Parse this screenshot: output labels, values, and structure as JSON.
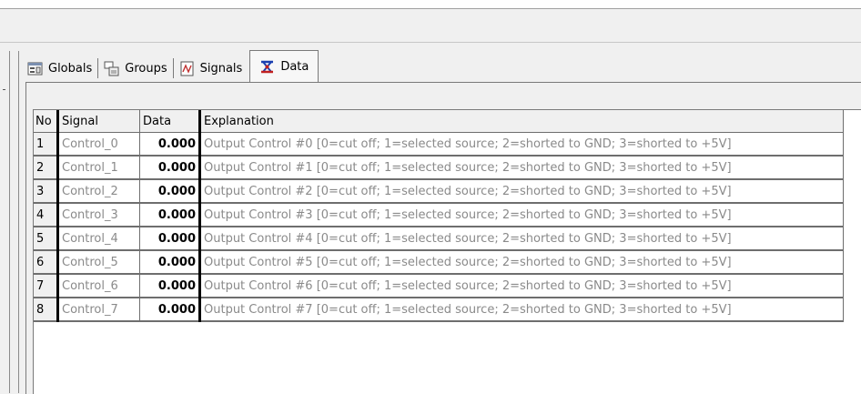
{
  "tabs": [
    {
      "label": "Globals",
      "icon": "globals-icon"
    },
    {
      "label": "Groups",
      "icon": "groups-icon"
    },
    {
      "label": "Signals",
      "icon": "signals-icon"
    },
    {
      "label": "Data",
      "icon": "data-icon",
      "active": true
    }
  ],
  "table": {
    "headers": {
      "no": "No",
      "signal": "Signal",
      "data": "Data",
      "explanation": "Explanation"
    },
    "rows": [
      {
        "no": "1",
        "signal": "Control_0",
        "data": "0.000",
        "explanation": "Output Control #0 [0=cut off; 1=selected source; 2=shorted to GND; 3=shorted to +5V]"
      },
      {
        "no": "2",
        "signal": "Control_1",
        "data": "0.000",
        "explanation": "Output Control #1 [0=cut off; 1=selected source; 2=shorted to GND; 3=shorted to +5V]"
      },
      {
        "no": "3",
        "signal": "Control_2",
        "data": "0.000",
        "explanation": "Output Control #2 [0=cut off; 1=selected source; 2=shorted to GND; 3=shorted to +5V]"
      },
      {
        "no": "4",
        "signal": "Control_3",
        "data": "0.000",
        "explanation": "Output Control #3 [0=cut off; 1=selected source; 2=shorted to GND; 3=shorted to +5V]"
      },
      {
        "no": "5",
        "signal": "Control_4",
        "data": "0.000",
        "explanation": "Output Control #4 [0=cut off; 1=selected source; 2=shorted to GND; 3=shorted to +5V]"
      },
      {
        "no": "6",
        "signal": "Control_5",
        "data": "0.000",
        "explanation": "Output Control #5 [0=cut off; 1=selected source; 2=shorted to GND; 3=shorted to +5V]"
      },
      {
        "no": "7",
        "signal": "Control_6",
        "data": "0.000",
        "explanation": "Output Control #6 [0=cut off; 1=selected source; 2=shorted to GND; 3=shorted to +5V]"
      },
      {
        "no": "8",
        "signal": "Control_7",
        "data": "0.000",
        "explanation": "Output Control #7 [0=cut off; 1=selected source; 2=shorted to GND; 3=shorted to +5V]"
      }
    ]
  }
}
